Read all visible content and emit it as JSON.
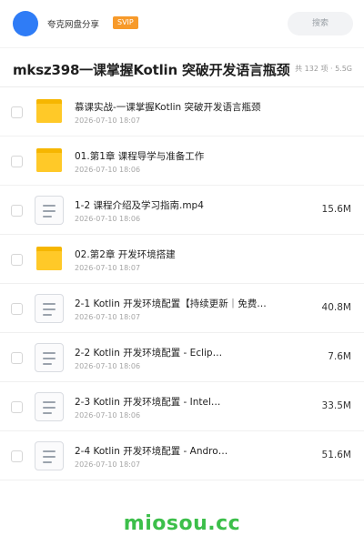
{
  "header": {
    "username": "夸克网盘分享",
    "badge": "SVIP",
    "search_placeholder": "搜索"
  },
  "title_bar": {
    "title": "mksz398一课掌握Kotlin 突破开发语言瓶颈",
    "meta": "共 132 项 · 5.5G"
  },
  "items": [
    {
      "type": "folder",
      "name": "慕课实战-一课掌握Kotlin 突破开发语言瓶颈",
      "date": "2026-07-10 18:07",
      "size": ""
    },
    {
      "type": "folder",
      "name": "01.第1章 课程导学与准备工作",
      "date": "2026-07-10 18:06",
      "size": ""
    },
    {
      "type": "file",
      "name": "1-2 课程介绍及学习指南.mp4",
      "date": "2026-07-10 18:06",
      "size": "15.6M"
    },
    {
      "type": "folder",
      "name": "02.第2章 开发环境搭建",
      "date": "2026-07-10 18:07",
      "size": ""
    },
    {
      "type": "file",
      "name": "2-1 Kotlin 开发环境配置【持续更新｜免费…",
      "date": "2026-07-10 18:07",
      "size": "40.8M"
    },
    {
      "type": "file",
      "name": "2-2 Kotlin 开发环境配置 - Eclip…",
      "date": "2026-07-10 18:06",
      "size": "7.6M"
    },
    {
      "type": "file",
      "name": "2-3 Kotlin 开发环境配置 - Intel…",
      "date": "2026-07-10 18:06",
      "size": "33.5M"
    },
    {
      "type": "file",
      "name": "2-4 Kotlin 开发环境配置 - Andro…",
      "date": "2026-07-10 18:07",
      "size": "51.6M"
    }
  ],
  "watermark": "miosou.cc",
  "colors": {
    "accent_blue": "#2f7cf6",
    "svip_orange": "#f79a2a",
    "folder_yellow": "#ffc928",
    "watermark_green": "#3cbf4a"
  },
  "icons": {
    "folder": "folder-icon",
    "file": "document-icon"
  }
}
